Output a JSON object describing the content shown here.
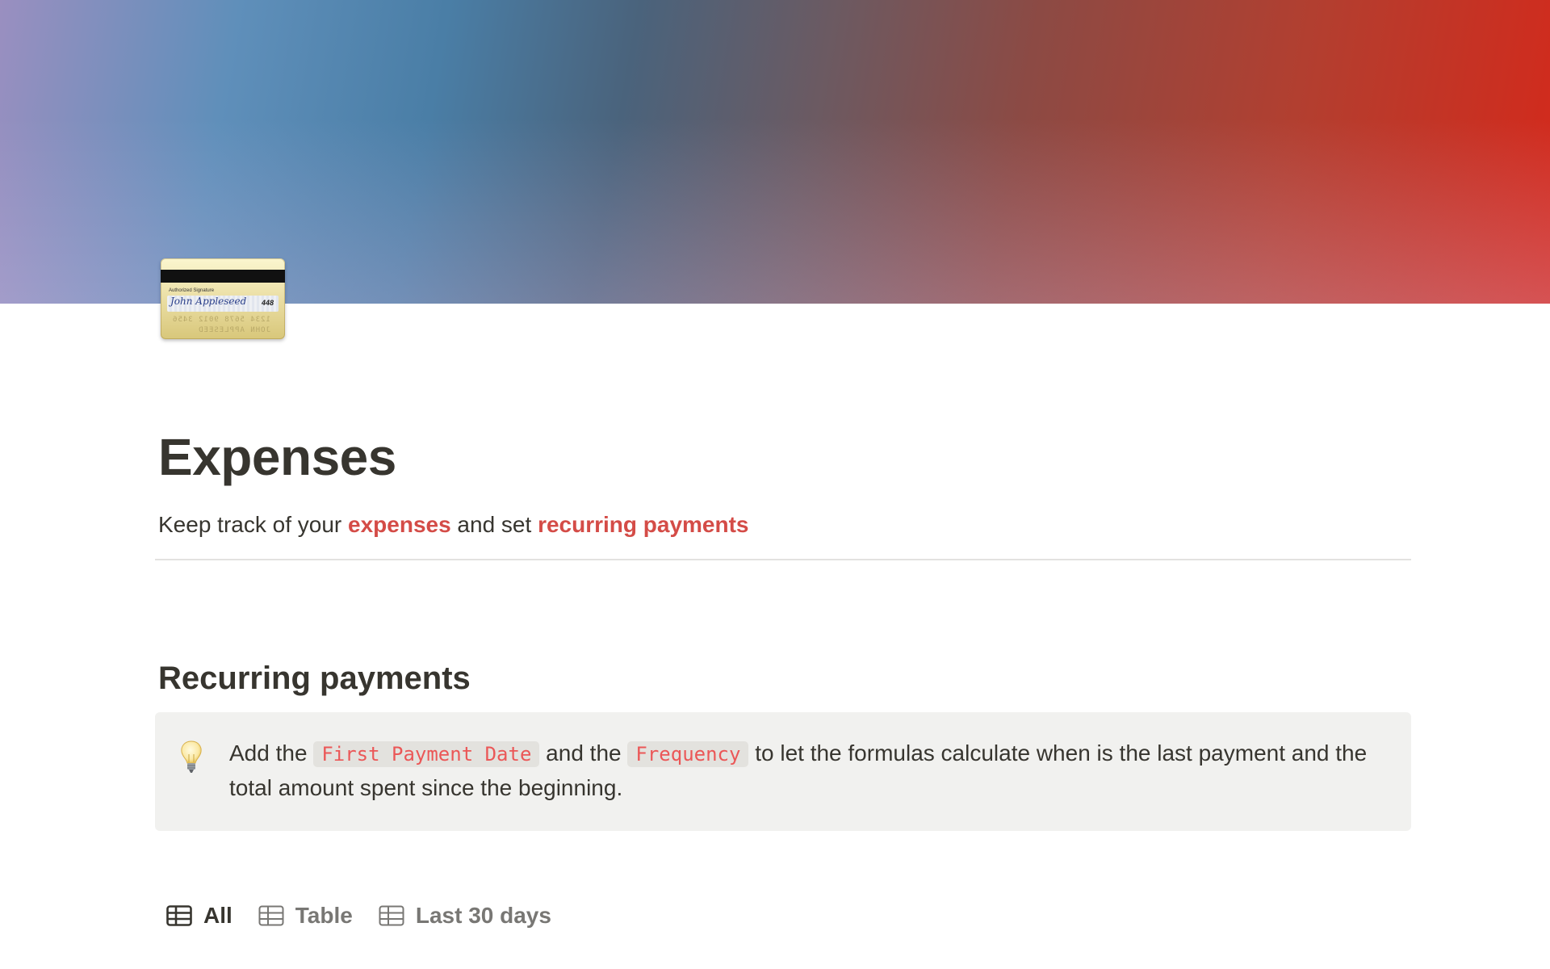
{
  "page": {
    "title": "Expenses",
    "subtitle": {
      "before": "Keep track of your ",
      "link1": "expenses",
      "middle": " and set ",
      "link2": "recurring payments"
    },
    "icon": {
      "name": "credit-card-icon",
      "signature_label": "Authorized Signature",
      "signature_name": "John Appleseed",
      "cvv": "448"
    }
  },
  "section": {
    "heading": "Recurring payments",
    "callout": {
      "icon": "lightbulb-icon",
      "text_before": "Add the ",
      "code1": "First Payment Date",
      "text_middle": " and the ",
      "code2": "Frequency",
      "text_after": " to let the formulas calculate when is the last payment and the total amount spent since the beginning."
    }
  },
  "views": {
    "tabs": [
      {
        "label": "All",
        "icon": "table-icon",
        "active": true
      },
      {
        "label": "Table",
        "icon": "table-icon",
        "active": false
      },
      {
        "label": "Last 30 days",
        "icon": "table-icon",
        "active": false
      }
    ]
  },
  "colors": {
    "accent_red": "#d44c47",
    "code_red": "#eb5757",
    "callout_bg": "#f1f1ef",
    "text": "#37352f",
    "muted": "#787774"
  }
}
